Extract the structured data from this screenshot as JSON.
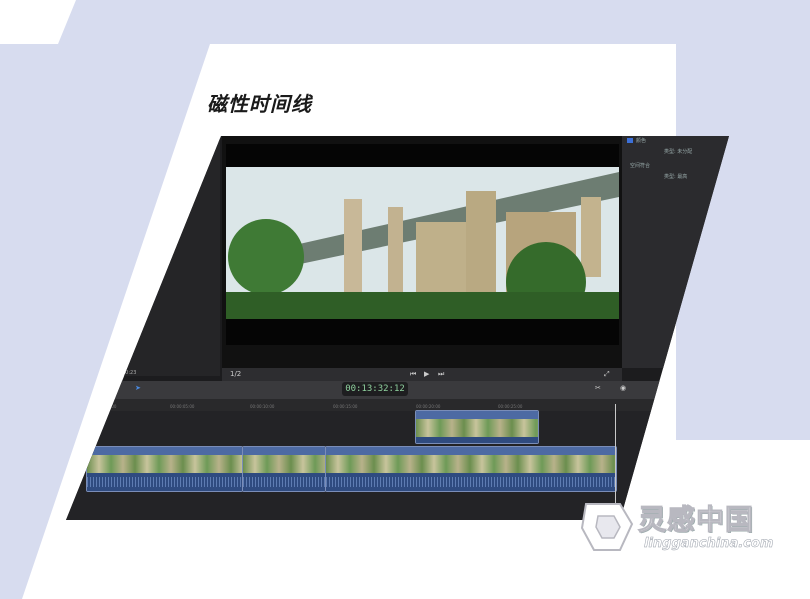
{
  "slide": {
    "title": "磁性时间线"
  },
  "inspector": {
    "rows": [
      "颜色",
      "类型:  未分配",
      "空间符合",
      "类型:  最高"
    ]
  },
  "viewer": {
    "zoom_label": "1/2",
    "left_counter": "00:23",
    "timecode": "00:13:32:12"
  },
  "ruler": {
    "ticks": [
      "00:00:00:00",
      "00:00:05:00",
      "00:00:10:00",
      "00:00:15:00",
      "00:00:20:00",
      "00:00:25:00"
    ]
  },
  "timeline": {
    "clips": [
      "",
      "",
      ""
    ]
  },
  "watermark": {
    "brand": "灵感中国",
    "url": "lingganchina.com"
  }
}
